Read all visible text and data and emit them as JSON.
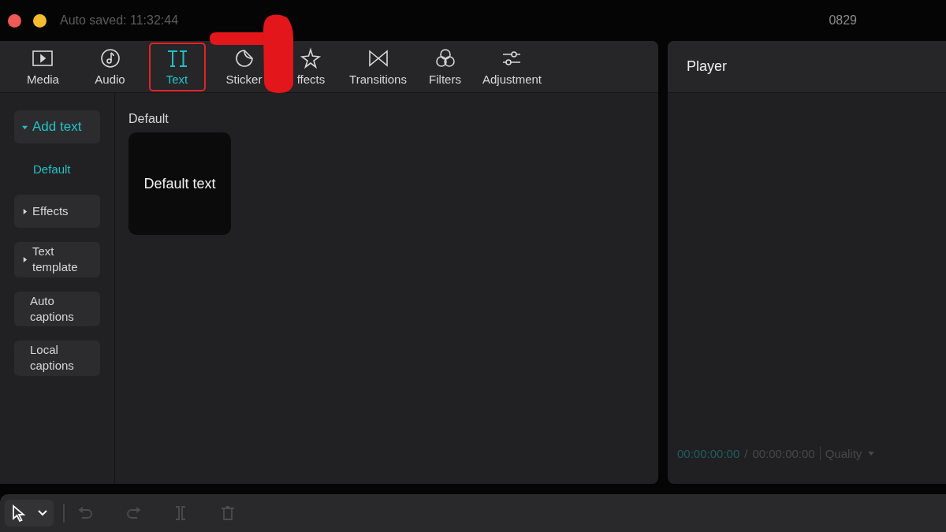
{
  "title_bar": {
    "autosave": "Auto saved: 11:32:44",
    "project": "0829"
  },
  "tabs": [
    {
      "label": "Media",
      "selected": false
    },
    {
      "label": "Audio",
      "selected": false
    },
    {
      "label": "Text",
      "selected": true
    },
    {
      "label": "Sticker",
      "selected": false
    },
    {
      "label": "ffects",
      "selected": false
    },
    {
      "label": "Transitions",
      "selected": false
    },
    {
      "label": "Filters",
      "selected": false
    },
    {
      "label": "Adjustment",
      "selected": false
    }
  ],
  "sidebar": {
    "items": [
      {
        "kind": "group",
        "label": "Add text",
        "expanded": true
      },
      {
        "kind": "sub",
        "label": "Default",
        "selected": true
      },
      {
        "kind": "group",
        "label": "Effects",
        "expanded": false
      },
      {
        "kind": "group",
        "label": "Text template",
        "expanded": false
      },
      {
        "kind": "item",
        "label": "Auto captions"
      },
      {
        "kind": "item",
        "label": "Local captions"
      }
    ]
  },
  "content": {
    "heading": "Default",
    "cards": [
      {
        "label": "Default text"
      }
    ]
  },
  "player": {
    "title": "Player",
    "current_time": "00:00:00:00",
    "separator": "/",
    "total_time": "00:00:00:00",
    "quality": "Quality"
  },
  "toolbar": [
    {
      "kind": "select",
      "disabled": false
    },
    {
      "kind": "undo",
      "disabled": true
    },
    {
      "kind": "redo",
      "disabled": true
    },
    {
      "kind": "split",
      "disabled": true
    },
    {
      "kind": "delete",
      "disabled": true
    }
  ]
}
